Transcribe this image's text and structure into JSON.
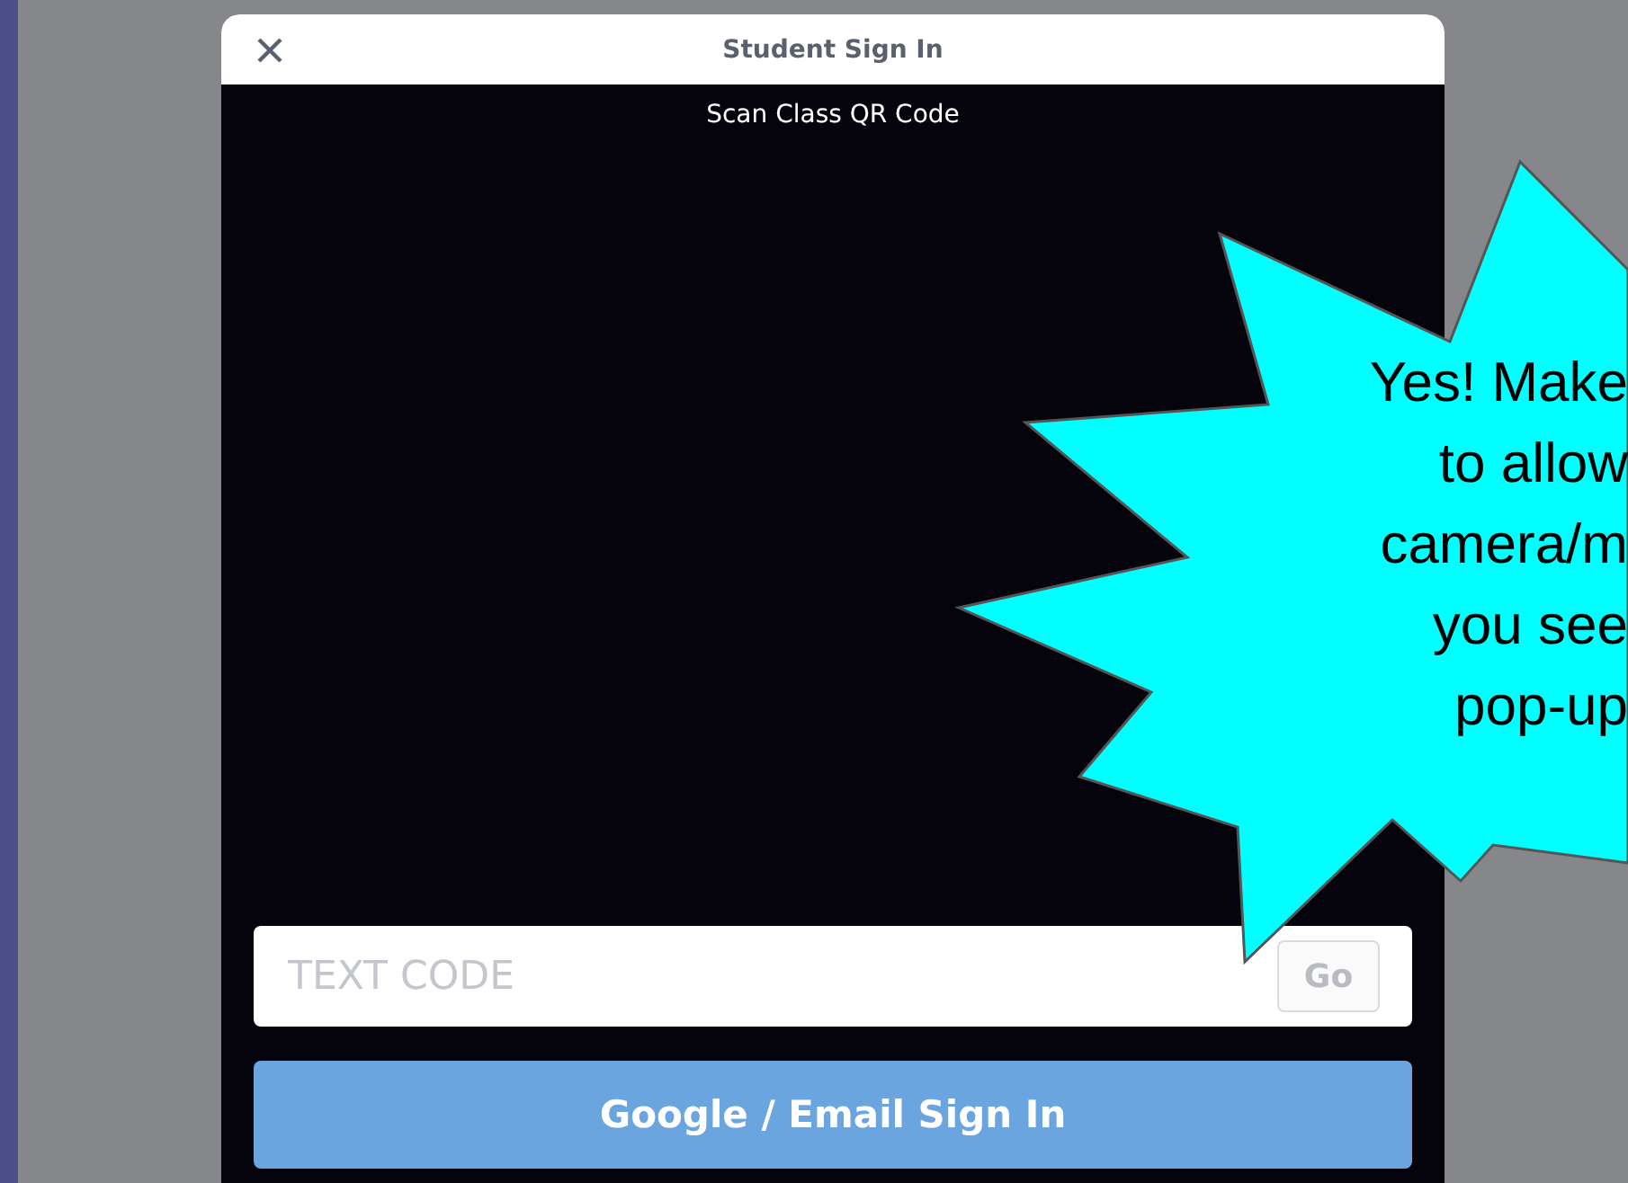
{
  "modal": {
    "title": "Student Sign In",
    "subtitle": "Scan Class QR Code"
  },
  "code_field": {
    "placeholder": "TEXT CODE"
  },
  "go_button": {
    "label": "Go",
    "disabled": true
  },
  "sign_in_button": {
    "label": "Google / Email Sign In"
  },
  "callout": {
    "lines": [
      "Yes! Make",
      "to allow",
      "camera/m",
      "you see",
      "pop-up"
    ]
  }
}
